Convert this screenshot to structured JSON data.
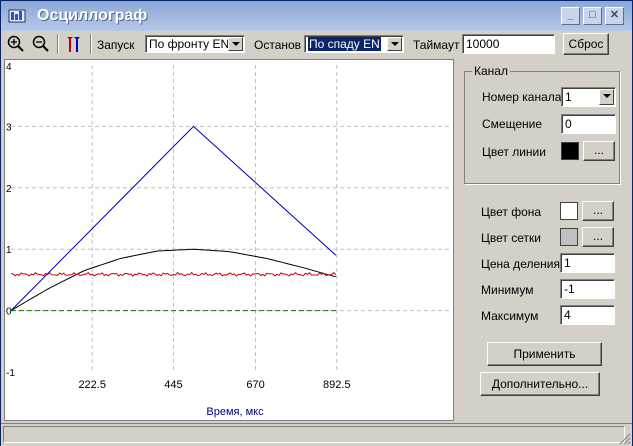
{
  "window": {
    "title": "Осциллограф",
    "brand_color": "#3a5fcd"
  },
  "title_buttons": {
    "minimize": "_",
    "maximize": "□",
    "close": "✕"
  },
  "toolbar": {
    "trigger_label": "Запуск",
    "trigger_value": "По фронту EN",
    "stop_label": "Останов",
    "stop_value": "По спаду EN",
    "timeout_label": "Таймаут",
    "timeout_value": "10000",
    "reset_label": "Сброс",
    "icons": [
      "zoom-in-icon",
      "zoom-out-icon",
      "markers-icon"
    ]
  },
  "chart_data": {
    "type": "line",
    "xlabel": "Время, мкс",
    "ylabel": "",
    "x_ticks": [
      "222.5",
      "445",
      "670",
      "892.5"
    ],
    "y_ticks": [
      "4",
      "3",
      "2",
      "1",
      "0",
      "-1"
    ],
    "xlim": [
      0,
      1200
    ],
    "ylim": [
      -1,
      4
    ],
    "grid": true,
    "series": [
      {
        "color": "#0000c0",
        "x": [
          0,
          500,
          890
        ],
        "y": [
          0,
          3,
          0.9
        ]
      },
      {
        "color": "#000000",
        "x": [
          0,
          100,
          200,
          300,
          400,
          500,
          600,
          700,
          800,
          890
        ],
        "y": [
          0,
          0.35,
          0.65,
          0.85,
          0.97,
          1.0,
          0.96,
          0.85,
          0.7,
          0.55
        ]
      },
      {
        "color": "#cc0000",
        "x": [
          0,
          100,
          200,
          300,
          400,
          500,
          600,
          700,
          800,
          890
        ],
        "y": [
          0.6,
          0.58,
          0.6,
          0.6,
          0.58,
          0.6,
          0.6,
          0.58,
          0.6,
          0.58
        ]
      },
      {
        "color": "#008000",
        "dashed": true,
        "x": [
          0,
          890
        ],
        "y": [
          0,
          0
        ]
      }
    ]
  },
  "channel": {
    "group_title": "Канал",
    "number_label": "Номер канала",
    "number_value": "1",
    "offset_label": "Смещение",
    "offset_value": "0",
    "line_color_label": "Цвет линии",
    "line_color": "#000000",
    "dots": "..."
  },
  "settings": {
    "bg_color_label": "Цвет фона",
    "bg_color": "#ffffff",
    "grid_color_label": "Цвет сетки",
    "grid_color": "#c0c0c0",
    "division_label": "Цена деления",
    "division_value": "1",
    "min_label": "Минимум",
    "min_value": "-1",
    "max_label": "Максимум",
    "max_value": "4",
    "dots": "..."
  },
  "buttons": {
    "apply": "Применить",
    "more": "Дополнительно..."
  }
}
